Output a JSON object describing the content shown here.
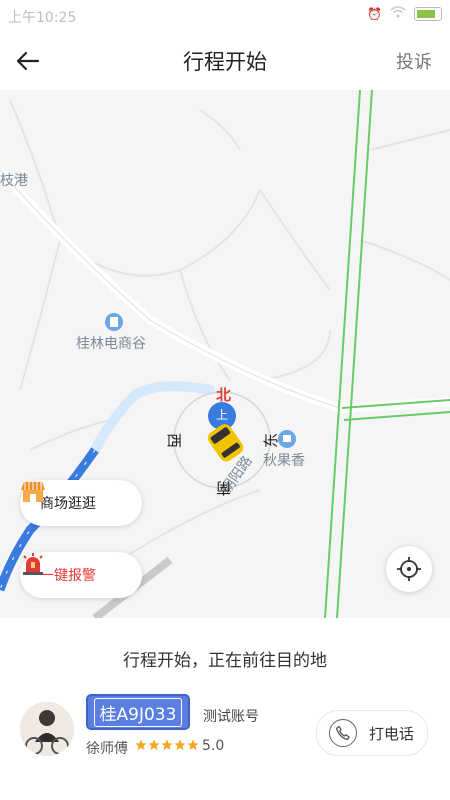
{
  "status_bar": {
    "time": "上午10:25",
    "icons": [
      "alarm-icon",
      "wifi-icon",
      "battery-icon"
    ]
  },
  "header": {
    "back_icon": "arrow-left-icon",
    "title": "行程开始",
    "complain_label": "投诉"
  },
  "map": {
    "labels": {
      "top_left": "枝港",
      "mall": "桂林电商谷",
      "shop": "秋果香",
      "road": "朝阳路"
    },
    "compass": {
      "north": "北",
      "south": "南",
      "east": "东",
      "west": "西",
      "location_marker": "上"
    },
    "buttons": {
      "shopping": "商场逛逛",
      "alarm": "一键报警"
    },
    "colors": {
      "route": "#3a7be0",
      "green_road": "#66cc66",
      "alarm_text": "#e53935"
    }
  },
  "trip": {
    "status_text": "行程开始，正在前往目的地"
  },
  "driver": {
    "plate": "桂A9J033",
    "account": "测试账号",
    "name": "徐师傅",
    "rating_value": "5.0",
    "stars": 5,
    "call_label": "打电话"
  }
}
